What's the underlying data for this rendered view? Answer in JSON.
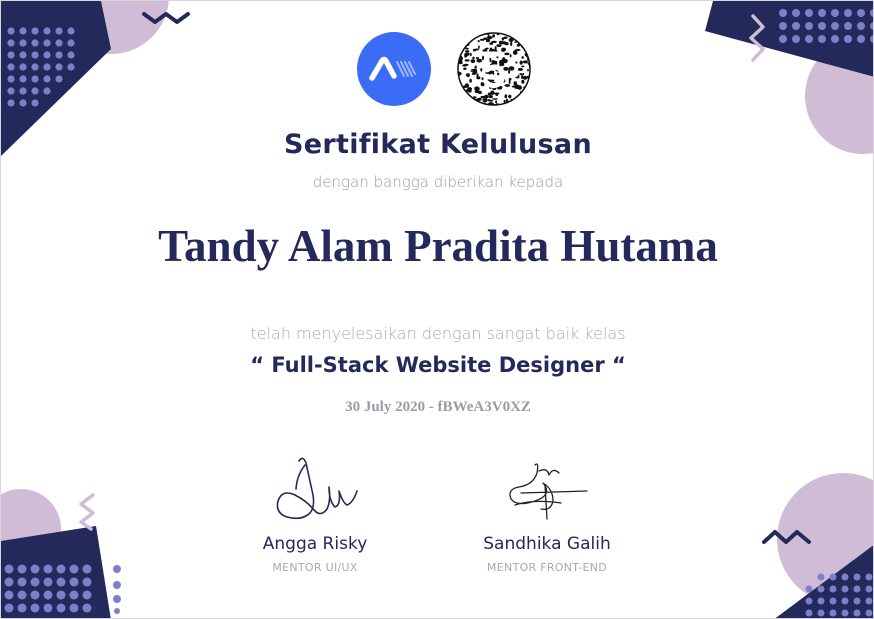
{
  "certificate": {
    "title": "Sertifikat Kelulusan",
    "subtitle": "dengan bangga diberikan kepada",
    "recipient": "Tandy Alam Pradita Hutama",
    "completion_text": "telah menyelesaikan dengan sangat baik kelas",
    "course": "“ Full-Stack Website Designer “",
    "date_code": "30 July 2020 - fBWeA3V0XZ"
  },
  "signatures": [
    {
      "name": "Angga Risky",
      "role": "MENTOR UI/UX"
    },
    {
      "name": "Sandhika Galih",
      "role": "MENTOR FRONT-END"
    }
  ],
  "icons": {
    "logo_primary": "buildwith-angga-logo-icon",
    "logo_secondary": "web-programming-unpas-logo-icon"
  },
  "colors": {
    "navy": "#23295a",
    "lavender": "#d0bcd6",
    "accent_blue": "#3b6cf5",
    "dot_blue": "#7b80c9",
    "muted_text": "#9a9aa5"
  }
}
